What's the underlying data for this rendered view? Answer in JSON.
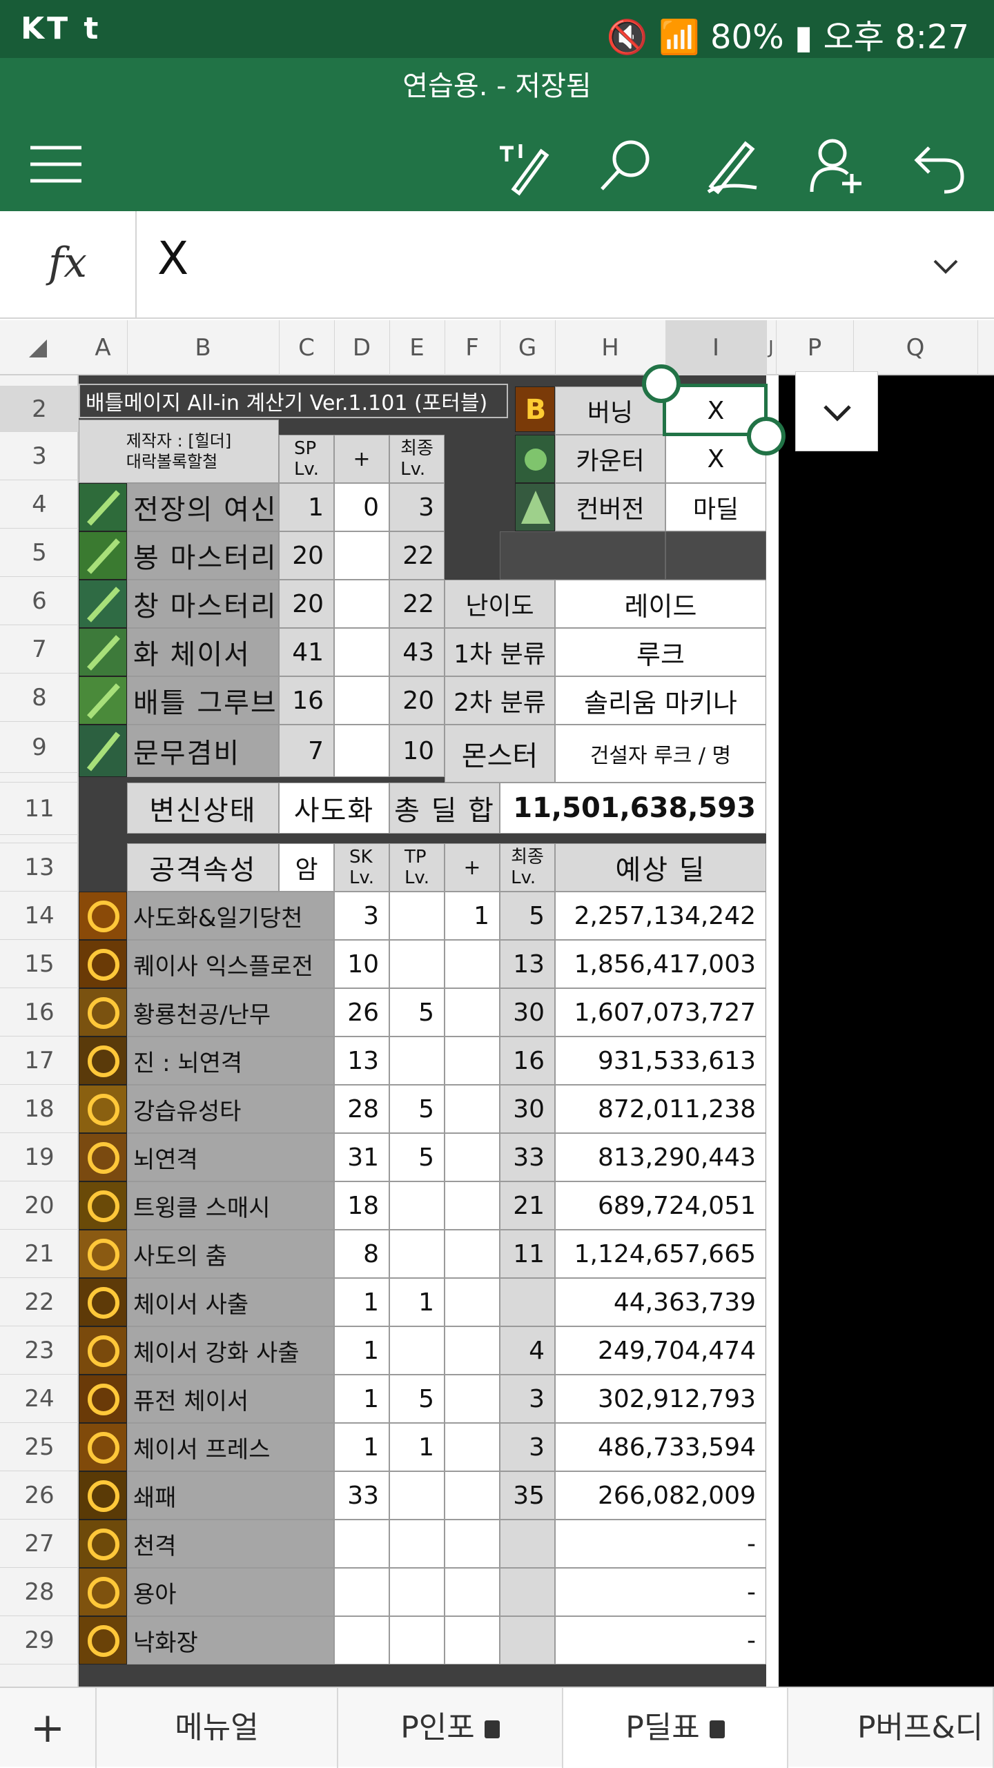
{
  "status_bar": {
    "carrier": "KT  t",
    "battery": "80%",
    "time": "오후 8:27"
  },
  "app": {
    "title": "연습용. - 저장됨"
  },
  "formula_bar": {
    "fx_label": "fx",
    "value": "X"
  },
  "columns": [
    "A",
    "B",
    "C",
    "D",
    "E",
    "F",
    "G",
    "H",
    "I",
    "J",
    "P",
    "Q"
  ],
  "rows": [
    "2",
    "3",
    "4",
    "5",
    "6",
    "7",
    "8",
    "9",
    "11",
    "13",
    "14",
    "15",
    "16",
    "17",
    "18",
    "19",
    "20",
    "21",
    "22",
    "23",
    "24",
    "25",
    "26",
    "27",
    "28",
    "29"
  ],
  "sheet": {
    "title": "배틀메이지 All-in 계산기 Ver.1.101 (포터블)",
    "author": "제작자 : [힐더]\n대락볼록할철",
    "head_sp": "SP\nLv.",
    "head_plus": "+",
    "head_final": "최종\nLv.",
    "buffs": [
      {
        "name": "전장의 여신",
        "sp": "1",
        "plus": "0",
        "final": "3"
      },
      {
        "name": "봉 마스터리",
        "sp": "20",
        "plus": "",
        "final": "22"
      },
      {
        "name": "창 마스터리",
        "sp": "20",
        "plus": "",
        "final": "22"
      },
      {
        "name": "화 체이서",
        "sp": "41",
        "plus": "",
        "final": "43"
      },
      {
        "name": "배틀 그루브",
        "sp": "16",
        "plus": "",
        "final": "20"
      },
      {
        "name": "문무겸비",
        "sp": "7",
        "plus": "",
        "final": "10"
      }
    ],
    "options": [
      {
        "label": "버닝",
        "value": "X"
      },
      {
        "label": "카운터",
        "value": "X"
      },
      {
        "label": "컨버전",
        "value": "마딜"
      }
    ],
    "info": [
      {
        "label": "난이도",
        "value": "레이드"
      },
      {
        "label": "1차 분류",
        "value": "루크"
      },
      {
        "label": "2차 분류",
        "value": "솔리움 마키나"
      },
      {
        "label": "몬스터",
        "value": "건설자 루크 / 명"
      }
    ],
    "transform_label": "변신상태",
    "transform_value": "사도화",
    "total_label": "총 딜 합",
    "total_value": "11,501,638,593",
    "attr_label": "공격속성",
    "attr_value": "암",
    "head_sk": "SK\nLv.",
    "head_tp": "TP\nLv.",
    "head_plus2": "+",
    "head_final2": "최종\nLv.",
    "head_dmg": "예상 딜",
    "skills": [
      {
        "name": "사도화&일기당천",
        "sk": "3",
        "tp": "",
        "plus": "1",
        "final": "5",
        "dmg": "2,257,134,242"
      },
      {
        "name": "퀘이사 익스플로전",
        "sk": "10",
        "tp": "",
        "plus": "",
        "final": "13",
        "dmg": "1,856,417,003"
      },
      {
        "name": "황룡천공/난무",
        "sk": "26",
        "tp": "5",
        "plus": "",
        "final": "30",
        "dmg": "1,607,073,727"
      },
      {
        "name": "진 : 뇌연격",
        "sk": "13",
        "tp": "",
        "plus": "",
        "final": "16",
        "dmg": "931,533,613"
      },
      {
        "name": "강습유성타",
        "sk": "28",
        "tp": "5",
        "plus": "",
        "final": "30",
        "dmg": "872,011,238"
      },
      {
        "name": "뇌연격",
        "sk": "31",
        "tp": "5",
        "plus": "",
        "final": "33",
        "dmg": "813,290,443"
      },
      {
        "name": "트윙클 스매시",
        "sk": "18",
        "tp": "",
        "plus": "",
        "final": "21",
        "dmg": "689,724,051"
      },
      {
        "name": "사도의 춤",
        "sk": "8",
        "tp": "",
        "plus": "",
        "final": "11",
        "dmg": "1,124,657,665"
      },
      {
        "name": "체이서 사출",
        "sk": "1",
        "tp": "1",
        "plus": "",
        "final": "",
        "dmg": "44,363,739"
      },
      {
        "name": "체이서 강화 사출",
        "sk": "1",
        "tp": "",
        "plus": "",
        "final": "4",
        "dmg": "249,704,474"
      },
      {
        "name": "퓨전 체이서",
        "sk": "1",
        "tp": "5",
        "plus": "",
        "final": "3",
        "dmg": "302,912,793"
      },
      {
        "name": "체이서 프레스",
        "sk": "1",
        "tp": "1",
        "plus": "",
        "final": "3",
        "dmg": "486,733,594"
      },
      {
        "name": "쇄패",
        "sk": "33",
        "tp": "",
        "plus": "",
        "final": "35",
        "dmg": "266,082,009"
      },
      {
        "name": "천격",
        "sk": "",
        "tp": "",
        "plus": "",
        "final": "",
        "dmg": "-"
      },
      {
        "name": "용아",
        "sk": "",
        "tp": "",
        "plus": "",
        "final": "",
        "dmg": "-"
      },
      {
        "name": "낙화장",
        "sk": "",
        "tp": "",
        "plus": "",
        "final": "",
        "dmg": "-"
      }
    ]
  },
  "tabs": [
    {
      "label": "메뉴얼",
      "locked": false
    },
    {
      "label": "P인포",
      "locked": true
    },
    {
      "label": "P딜표",
      "locked": true,
      "active": true
    },
    {
      "label": "P버프&디",
      "locked": false
    }
  ],
  "colors": {
    "excel_green": "#217346",
    "status_green": "#185c37",
    "cell_gray": "#a6a6a6",
    "selection": "#217346"
  }
}
